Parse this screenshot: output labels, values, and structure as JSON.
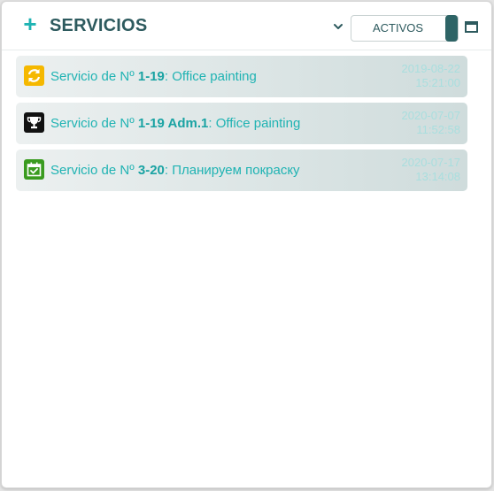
{
  "header": {
    "title": "SERVICIOS",
    "add_symbol": "+",
    "filter_label": "ACTIVOS"
  },
  "colors": {
    "accent": "#1fb3b3",
    "title": "#2d5a5e",
    "toggle_knob": "#2e6466"
  },
  "items": [
    {
      "prefix": "Servicio de Nº ",
      "number": "1-19",
      "separator": ": ",
      "subject": "Office painting",
      "date": "2019-08-22",
      "time": "15:21:00",
      "icon": "refresh-icon",
      "icon_color": "#f5b800"
    },
    {
      "prefix": "Servicio de Nº ",
      "number": "1-19 Adm.1",
      "separator": ": ",
      "subject": "Office painting",
      "date": "2020-07-07",
      "time": "11:52:58",
      "icon": "trophy-icon",
      "icon_color": "#111111"
    },
    {
      "prefix": "Servicio de Nº ",
      "number": "3-20",
      "separator": ": ",
      "subject": "Планируем покраску",
      "date": "2020-07-17",
      "time": "13:14:08",
      "icon": "calendar-check-icon",
      "icon_color": "#3a9b1f"
    }
  ]
}
